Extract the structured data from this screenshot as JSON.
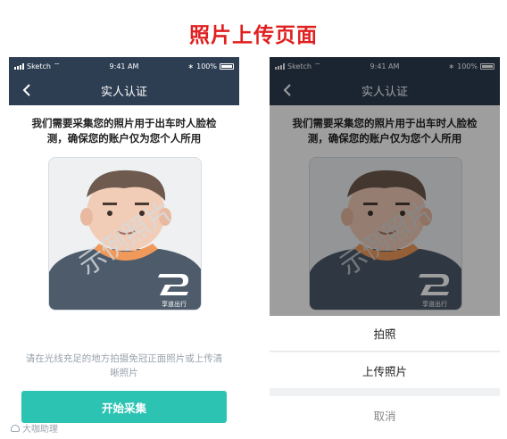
{
  "heading": "照片上传页面",
  "status_bar": {
    "carrier": "Sketch",
    "time": "9:41 AM",
    "battery": "100%"
  },
  "nav": {
    "title": "实人认证",
    "back_icon": "chevron-left-icon"
  },
  "intro_text": "我们需要采集您的照片用于出车时人脸检测，确保您的账户仅为您个人所用",
  "photo_placeholder": {
    "watermark_text": "示例照片",
    "badge_text": "享道出行",
    "badge_icon": "brand-logo-icon"
  },
  "hint_text": "请在光线充足的地方拍摄免冠正面照片或上传清晰照片",
  "start_button": "开始采集",
  "action_sheet": {
    "take_photo": "拍照",
    "upload_photo": "上传照片",
    "cancel": "取消"
  },
  "corner_watermark": "大咖助理",
  "colors": {
    "heading": "#e02020",
    "nav_bg": "#2d3d52",
    "primary": "#2cc3b3",
    "shirt": "#4d5b6b",
    "collar": "#f0995a"
  }
}
